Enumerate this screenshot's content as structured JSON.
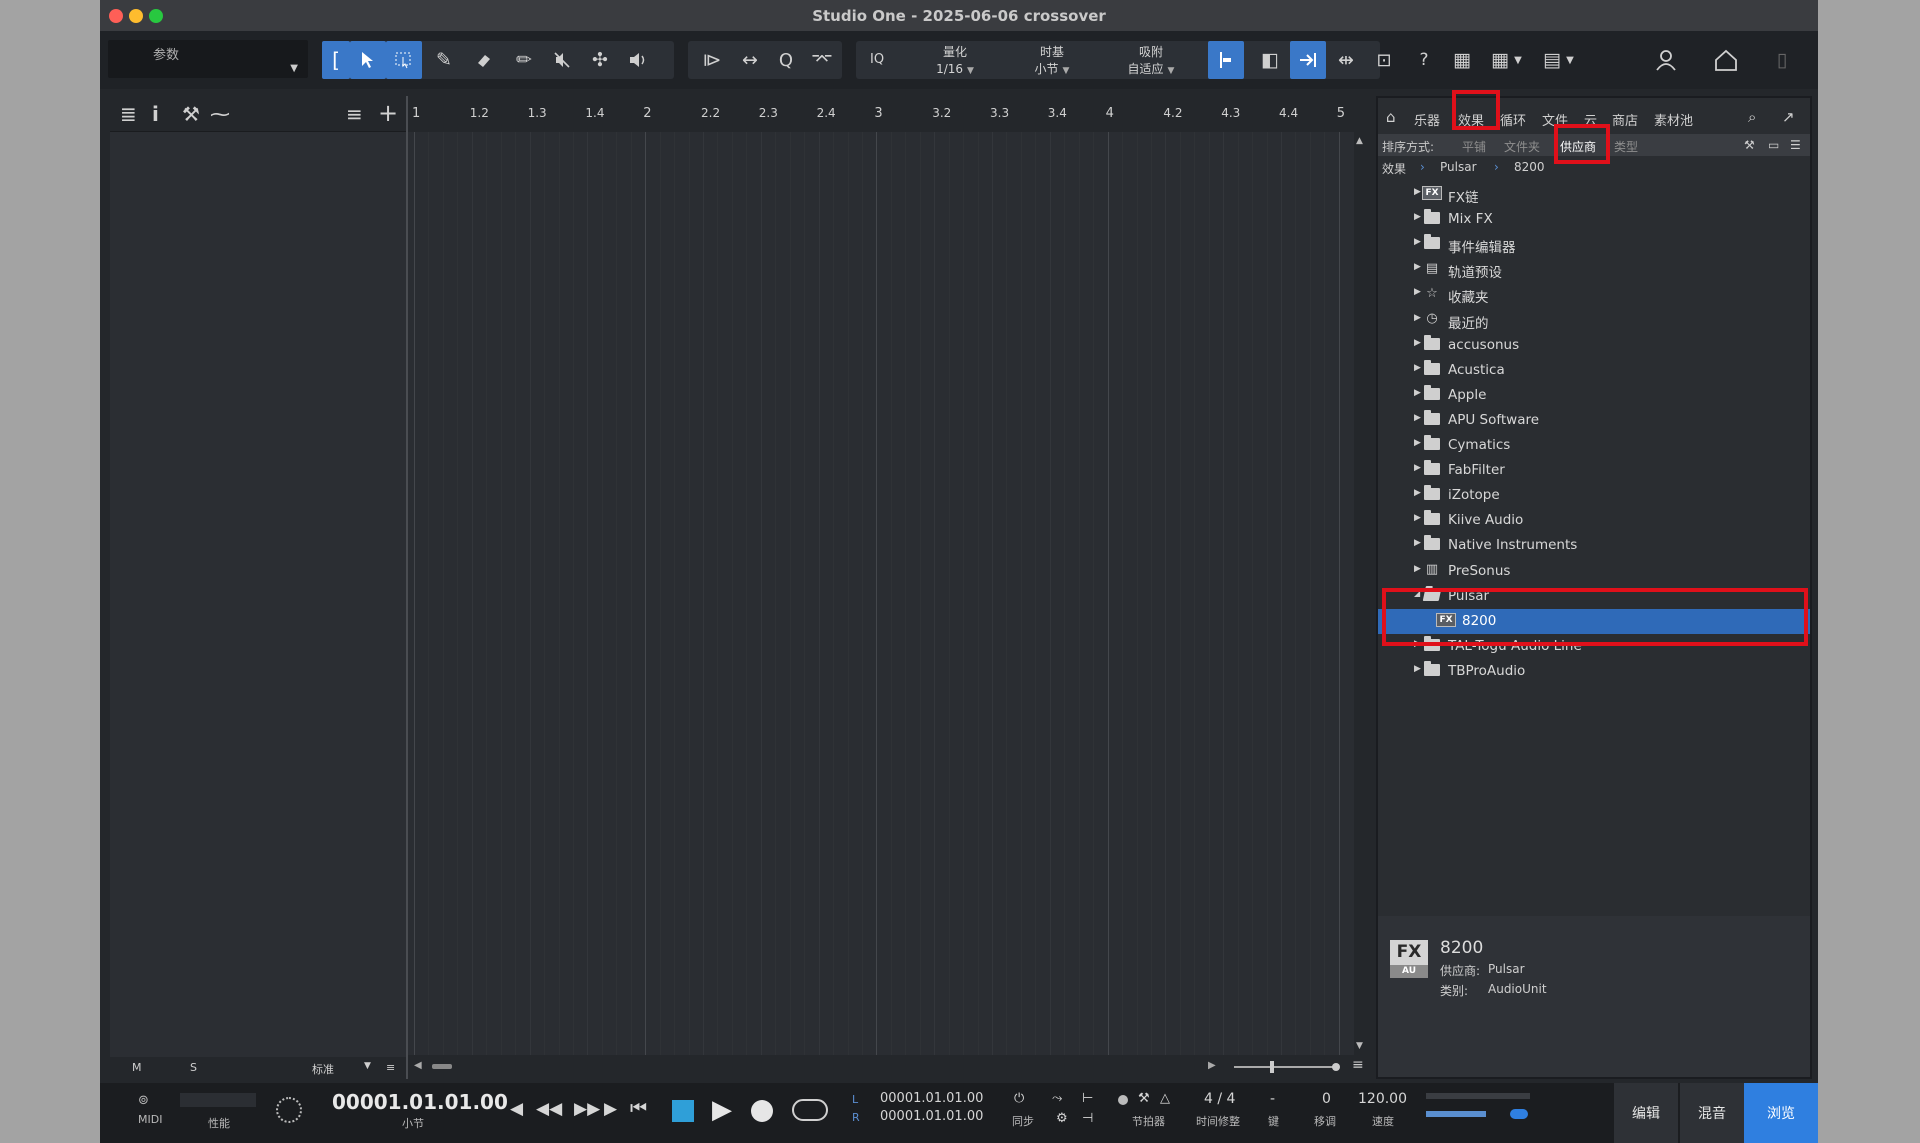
{
  "window": {
    "title": "Studio One - 2025-06-06 crossover"
  },
  "toolbar": {
    "param_label": "参数",
    "iq_label": "IQ",
    "quantize": {
      "label": "量化",
      "value": "1/16"
    },
    "timebase": {
      "label": "时基",
      "value": "小节"
    },
    "snap": {
      "label": "吸附",
      "value": "自适应"
    },
    "help_label": "?"
  },
  "ruler": {
    "ticks": [
      "1",
      "1.2",
      "1.3",
      "1.4",
      "2",
      "2.2",
      "2.3",
      "2.4",
      "3",
      "3.2",
      "3.3",
      "3.4",
      "4",
      "4.2",
      "4.3",
      "4.4",
      "5"
    ]
  },
  "left_panel": {
    "bottom": {
      "m": "M",
      "s": "S",
      "mode": "标准"
    }
  },
  "browser": {
    "tabs": [
      "乐器",
      "效果",
      "循环",
      "文件",
      "云",
      "商店",
      "素材池"
    ],
    "active_tab": "效果",
    "sort": {
      "label": "排序方式:",
      "options": [
        "平铺",
        "文件夹",
        "供应商",
        "类型"
      ],
      "active": "供应商"
    },
    "breadcrumb": [
      "效果",
      "Pulsar",
      "8200"
    ],
    "tree": [
      {
        "label": "FX链",
        "icon": "fx-chain-icon"
      },
      {
        "label": "Mix FX",
        "icon": "mixfx-icon"
      },
      {
        "label": "事件编辑器",
        "icon": "event-editor-icon"
      },
      {
        "label": "轨道预设",
        "icon": "track-preset-icon"
      },
      {
        "label": "收藏夹",
        "icon": "star-icon"
      },
      {
        "label": "最近的",
        "icon": "clock-icon"
      },
      {
        "label": "accusonus",
        "icon": "folder-icon"
      },
      {
        "label": "Acustica",
        "icon": "folder-icon"
      },
      {
        "label": "Apple",
        "icon": "folder-icon"
      },
      {
        "label": "APU Software",
        "icon": "folder-icon"
      },
      {
        "label": "Cymatics",
        "icon": "folder-icon"
      },
      {
        "label": "FabFilter",
        "icon": "folder-icon"
      },
      {
        "label": "iZotope",
        "icon": "folder-icon"
      },
      {
        "label": "Kiive Audio",
        "icon": "folder-icon"
      },
      {
        "label": "Native Instruments",
        "icon": "folder-icon"
      },
      {
        "label": "PreSonus",
        "icon": "presonus-icon"
      },
      {
        "label": "Pulsar",
        "icon": "folder-open-icon",
        "expanded": true
      },
      {
        "label": "8200",
        "icon": "fx-plugin-icon",
        "selected": true,
        "child": true
      },
      {
        "label": "TAL-Togu Audio Line",
        "icon": "folder-icon"
      },
      {
        "label": "TBProAudio",
        "icon": "folder-icon"
      }
    ],
    "info": {
      "fx_badge": "FX",
      "au_badge": "AU",
      "name": "8200",
      "vendor_label": "供应商:",
      "vendor": "Pulsar",
      "category_label": "类别:",
      "category": "AudioUnit"
    }
  },
  "transport": {
    "midi_label": "MIDI",
    "perf_label": "性能",
    "time": "00001.01.01.00",
    "time_unit": "小节",
    "loop_l_label": "L",
    "loop_r_label": "R",
    "loop_l": "00001.01.01.00",
    "loop_r": "00001.01.01.00",
    "sync_label": "同步",
    "metronome_label": "节拍器",
    "signature": "4 / 4",
    "signature_label": "时间修整",
    "key": "-",
    "key_label": "键",
    "transpose": "0",
    "transpose_label": "移调",
    "tempo": "120.00",
    "tempo_label": "速度",
    "views": [
      "编辑",
      "混音",
      "浏览"
    ],
    "active_view": "浏览"
  },
  "colors": {
    "accent": "#2f7fe0",
    "selection": "#2f6ab8",
    "highlight": "#e0101a"
  }
}
